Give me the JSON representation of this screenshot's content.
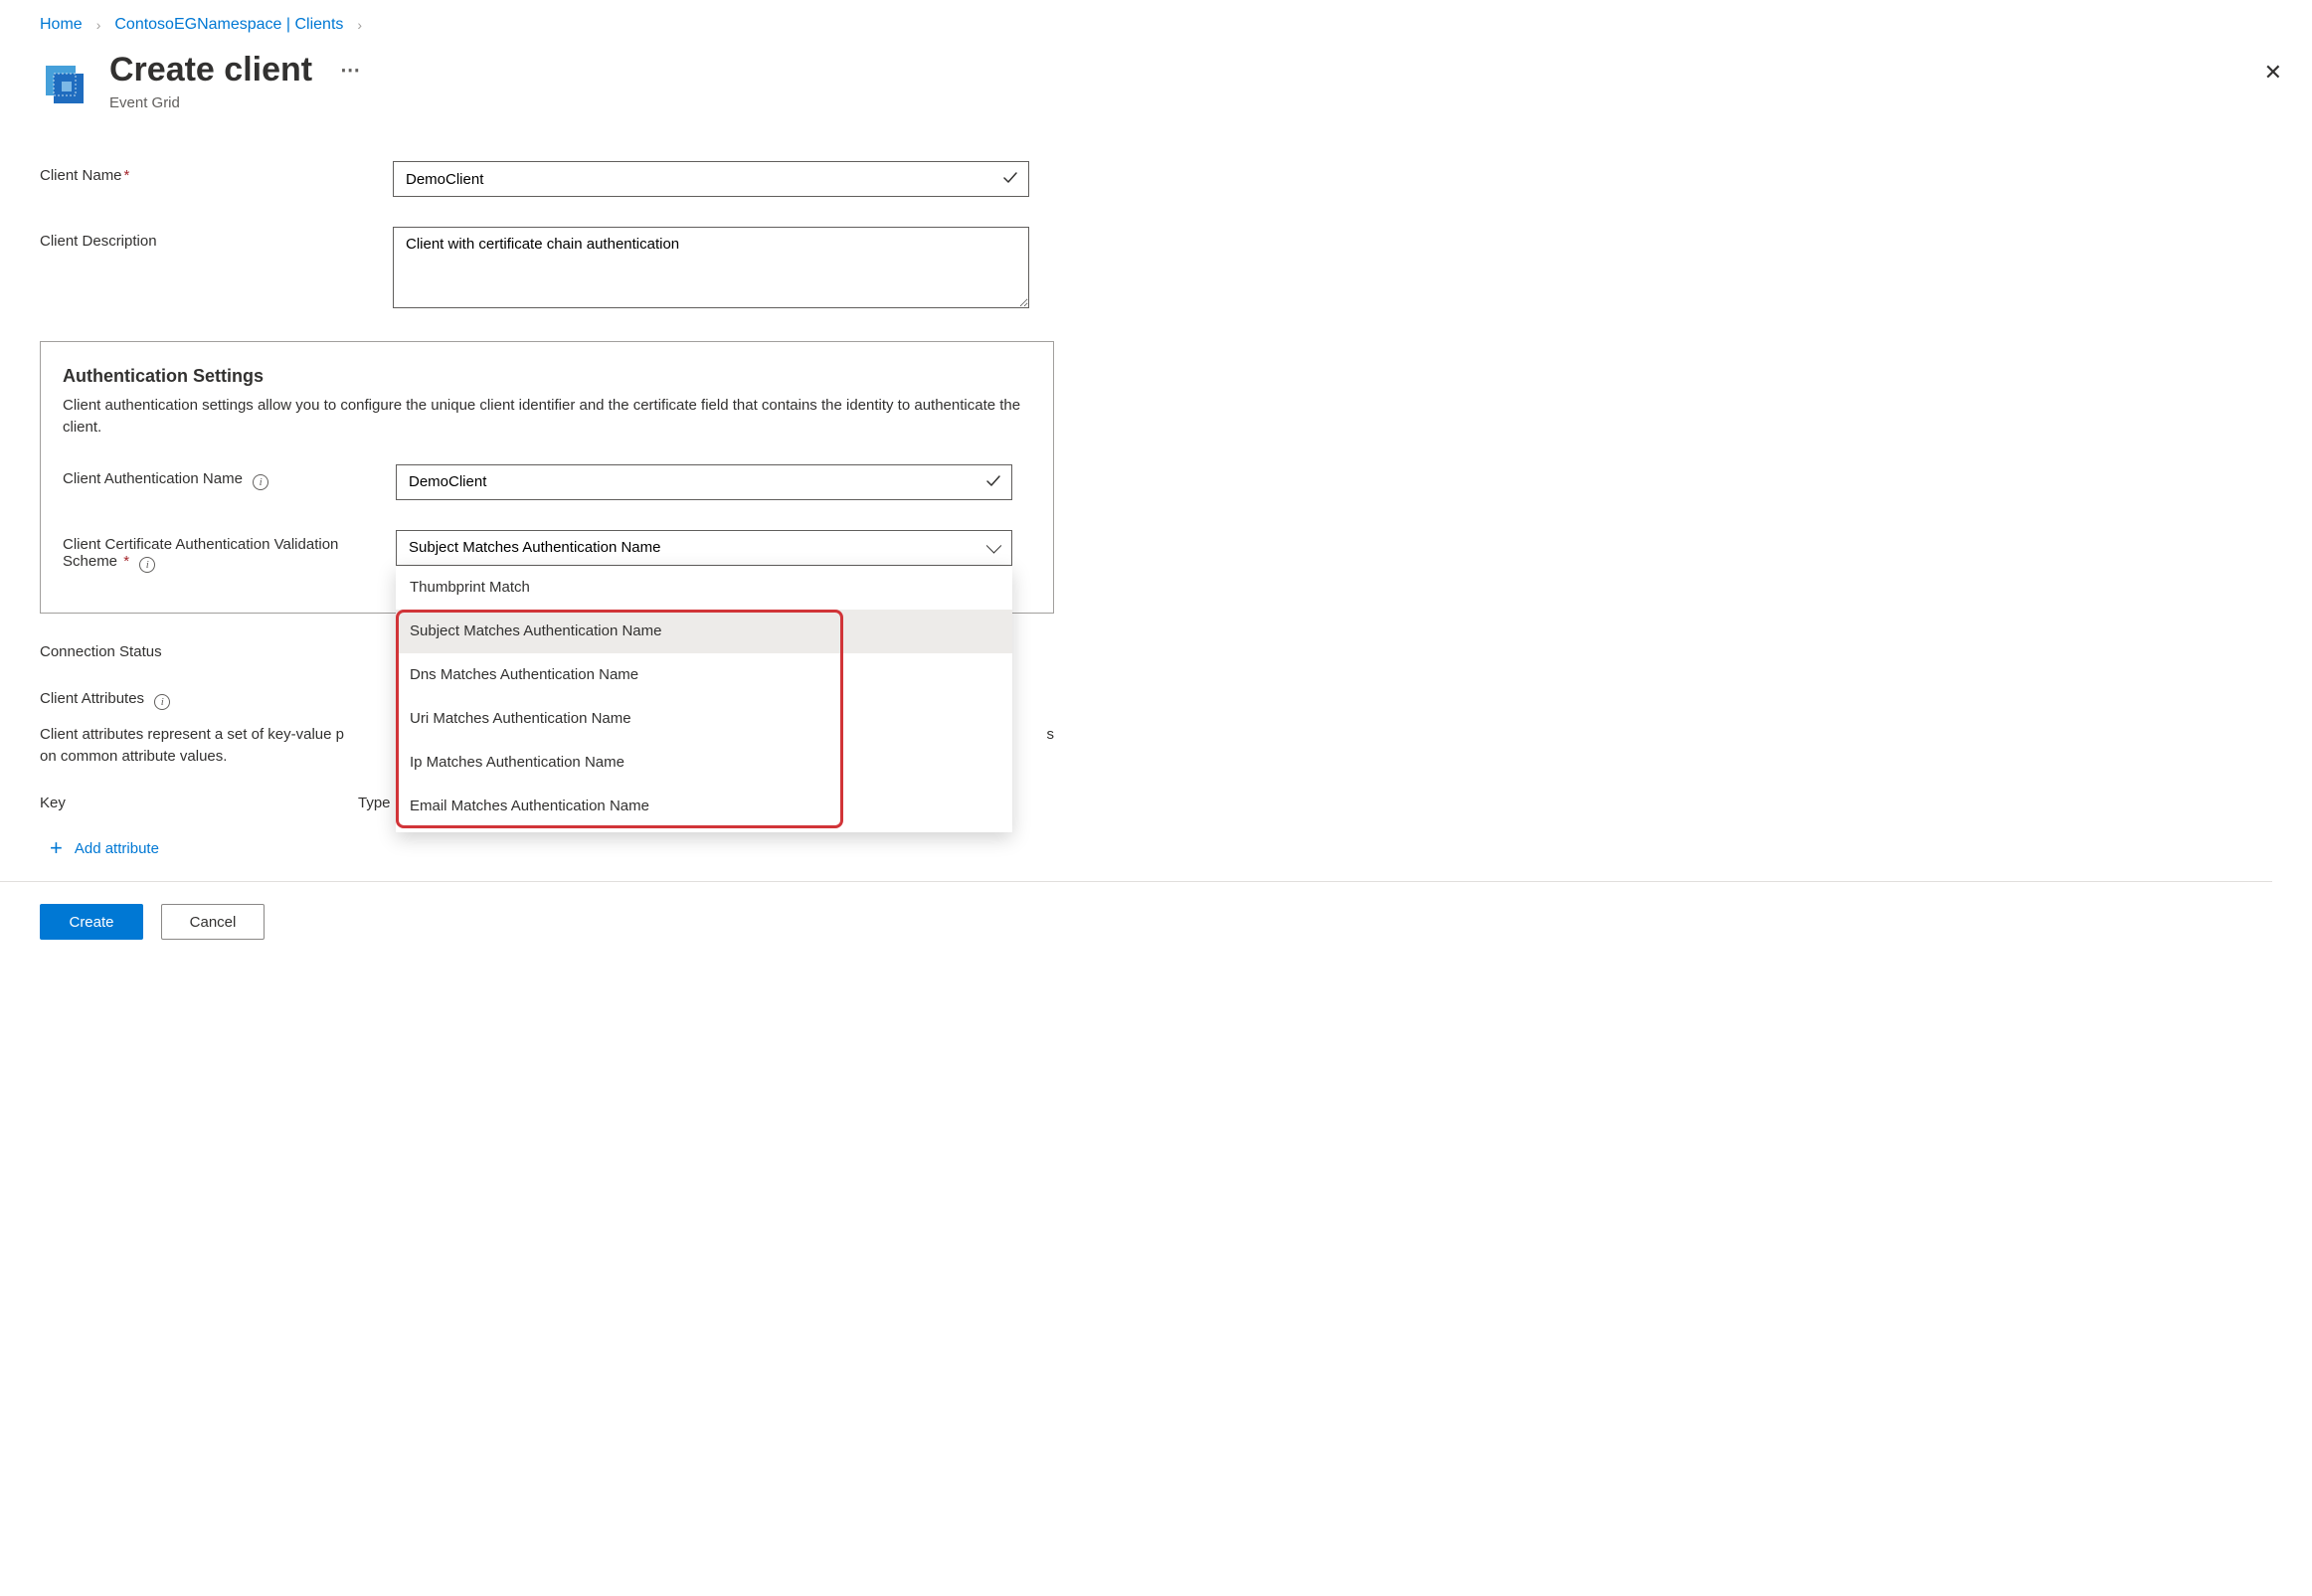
{
  "breadcrumb": {
    "home": "Home",
    "namespace": "ContosoEGNamespace | Clients"
  },
  "header": {
    "title": "Create client",
    "subtitle": "Event Grid"
  },
  "labels": {
    "client_name": "Client Name",
    "client_description": "Client Description",
    "auth_settings_title": "Authentication Settings",
    "auth_settings_desc": "Client authentication settings allow you to configure the unique client identifier and the certificate field that contains the identity to authenticate the client.",
    "client_auth_name": "Client Authentication Name",
    "validation_scheme": "Client Certificate Authentication Validation Scheme",
    "connection_status": "Connection Status",
    "client_attributes": "Client Attributes",
    "client_attributes_desc_1": "Client attributes represent a set of key-value p",
    "client_attributes_desc_2": "on common attribute values.",
    "col_key": "Key",
    "col_type": "Type",
    "add_attribute": "Add attribute"
  },
  "values": {
    "client_name": "DemoClient",
    "client_description": "Client with certificate chain authentication",
    "client_auth_name": "DemoClient",
    "validation_scheme_selected": "Subject Matches Authentication Name"
  },
  "validation_scheme_options": [
    "Thumbprint Match",
    "Subject Matches Authentication Name",
    "Dns Matches Authentication Name",
    "Uri Matches Authentication Name",
    "Ip Matches Authentication Name",
    "Email Matches Authentication Name"
  ],
  "buttons": {
    "create": "Create",
    "cancel": "Cancel"
  }
}
